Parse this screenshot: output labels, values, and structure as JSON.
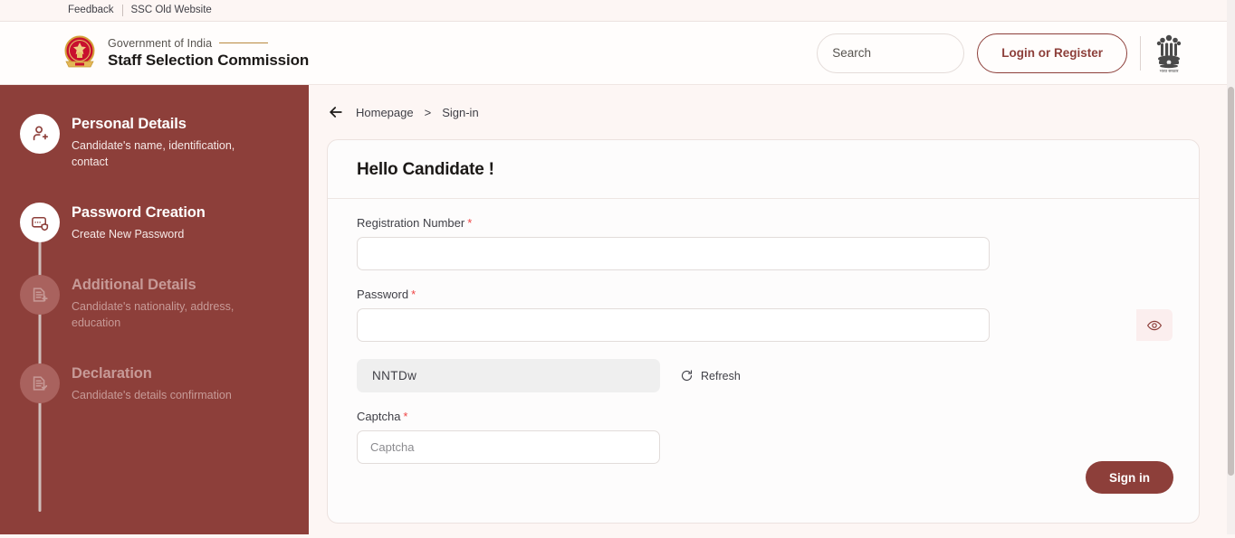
{
  "utility_bar": {
    "links": [
      {
        "label": "Feedback",
        "name": "feedback-link"
      },
      {
        "label": "SSC Old Website",
        "name": "ssc-old-website-link"
      }
    ]
  },
  "header": {
    "gov_label": "Government of India",
    "org_name": "Staff Selection Commission",
    "search": {
      "placeholder": "Search",
      "value": ""
    },
    "login_label": "Login or Register",
    "emblem_alt": "ssc-logo",
    "india_emblem_alt": "national-emblem"
  },
  "sidebar": {
    "steps": [
      {
        "title": "Personal Details",
        "desc": "Candidate's name, identification, contact",
        "state": "active",
        "icon": "user-add-icon"
      },
      {
        "title": "Password Creation",
        "desc": "Create New Password",
        "state": "active",
        "icon": "card-shield-icon"
      },
      {
        "title": "Additional Details",
        "desc": "Candidate's nationality, address, education",
        "state": "inactive",
        "icon": "document-add-icon"
      },
      {
        "title": "Declaration",
        "desc": "Candidate's details confirmation",
        "state": "inactive",
        "icon": "document-check-icon"
      }
    ]
  },
  "breadcrumb": {
    "back_icon": "back-arrow-icon",
    "home": "Homepage",
    "separator": ">",
    "current": "Sign-in"
  },
  "form": {
    "title": "Hello Candidate !",
    "registration": {
      "label": "Registration Number",
      "required": "*",
      "value": "",
      "placeholder": ""
    },
    "password": {
      "label": "Password",
      "required": "*",
      "value": "",
      "placeholder": "",
      "toggle_icon": "eye-icon"
    },
    "captcha_code": "NNTDw",
    "refresh_label": "Refresh",
    "refresh_icon": "refresh-icon",
    "captcha": {
      "label": "Captcha",
      "required": "*",
      "value": "",
      "placeholder": "Captcha"
    },
    "submit_label": "Sign in"
  },
  "colors": {
    "brand": "#8d3f3a",
    "page_bg": "#fdf6f4",
    "card_bg": "#fdfcfc",
    "required_red": "#ef4444",
    "gold_rule": "#b8893f"
  }
}
